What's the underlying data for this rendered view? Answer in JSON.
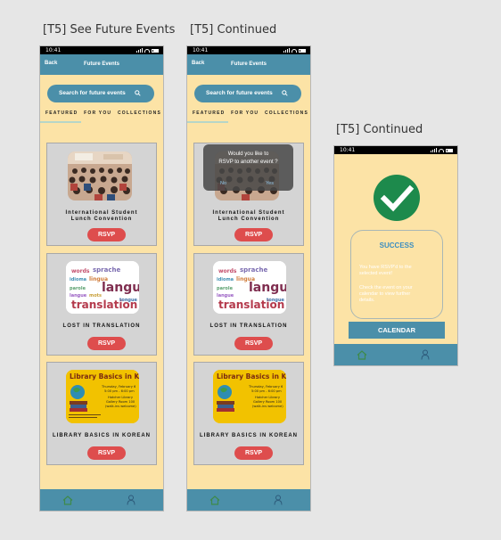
{
  "frames": [
    {
      "label": "[T5] See Future Events",
      "status_time": "10:41",
      "appbar": {
        "back": "Back",
        "title": "Future Events"
      },
      "search_placeholder": "Search for future events",
      "tabs": [
        "FEATURED",
        "FOR YOU",
        "COLLECTIONS"
      ],
      "events": [
        {
          "name": "International Student\nLunch Convention",
          "rsvp": "RSVP"
        },
        {
          "name": "LOST IN TRANSLATION",
          "rsvp": "RSVP"
        },
        {
          "name": "LIBRARY BASICS IN KOREAN",
          "rsvp": "RSVP"
        }
      ]
    },
    {
      "label": "[T5] Continued",
      "status_time": "10:41",
      "appbar": {
        "back": "Back",
        "title": "Future Events"
      },
      "search_placeholder": "Search for future events",
      "tabs": [
        "FEATURED",
        "FOR YOU",
        "COLLECTIONS"
      ],
      "dialog": {
        "question": "Would you like to\nRSVP to another event ?",
        "no": "No",
        "yes": "Yes"
      },
      "events": [
        {
          "name": "International Student\nLunch Convention",
          "rsvp": "RSVP"
        },
        {
          "name": "LOST IN TRANSLATION",
          "rsvp": "RSVP"
        },
        {
          "name": "LIBRARY BASICS IN KOREAN",
          "rsvp": "RSVP"
        }
      ]
    },
    {
      "label": "[T5] Continued",
      "status_time": "10:41",
      "success": {
        "heading": "SUCCESS",
        "line1": "You have RSVP'd to the\nselected event!",
        "line2": "Check the event on your\ncalendar to view further\ndetails."
      },
      "calendar_button": "CALENDAR"
    }
  ],
  "poster_text": {
    "library_title": "Library Basics in Korean",
    "library_when": "Thursday, February 6\n5:00 pm - 6:00 pm",
    "library_where": "Hatcher Library\nGallery Room 100\n(walk-ins welcome)",
    "translation_words": [
      "language",
      "translation"
    ]
  },
  "colors": {
    "background": "#e6e6e6",
    "phone_bg": "#fce3a6",
    "accent": "#4b8fa9",
    "rsvp": "#de4d4d",
    "success_check": "#1d8a4c"
  }
}
